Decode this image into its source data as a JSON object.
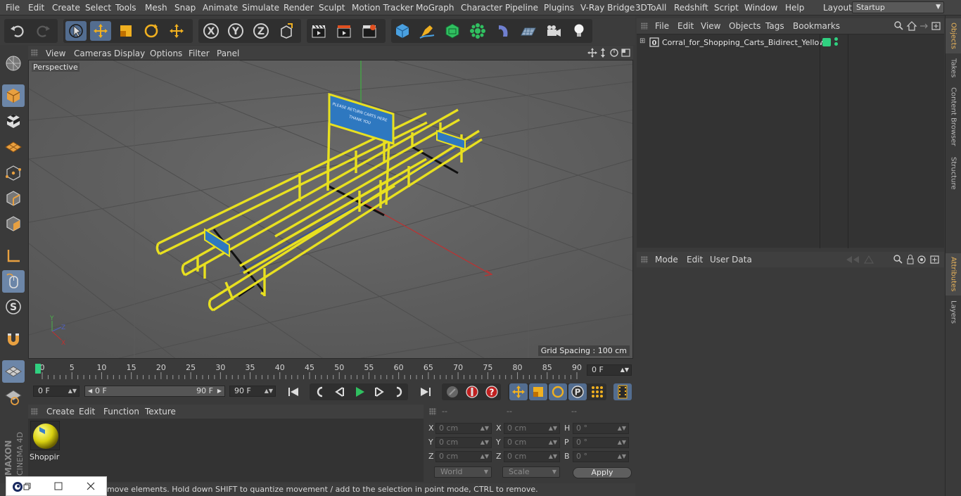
{
  "menubar": {
    "items": [
      "File",
      "Edit",
      "Create",
      "Select",
      "Tools",
      "Mesh",
      "Snap",
      "Animate",
      "Simulate",
      "Render",
      "Sculpt",
      "Motion Tracker",
      "MoGraph",
      "Character",
      "Pipeline",
      "Plugins",
      "V-Ray Bridge",
      "3DToAll",
      "Redshift",
      "Script",
      "Window",
      "Help"
    ],
    "layout_label": "Layout:",
    "layout_value": "Startup"
  },
  "viewport": {
    "menu": [
      "View",
      "Cameras",
      "Display",
      "Options",
      "Filter",
      "Panel"
    ],
    "name": "Perspective",
    "grid_spacing": "Grid Spacing : 100 cm",
    "sign_line1": "PLEASE RETURN CARTS HERE",
    "sign_line2": "THANK YOU",
    "axis_x": "X",
    "axis_y": "Y",
    "axis_z": "Z"
  },
  "timeline": {
    "ticks": [
      "0",
      "5",
      "10",
      "15",
      "20",
      "25",
      "30",
      "35",
      "40",
      "45",
      "50",
      "55",
      "60",
      "65",
      "70",
      "75",
      "80",
      "85",
      "90"
    ],
    "current_frame": "0 F"
  },
  "playback": {
    "start_field": "0 F",
    "range_start": "0 F",
    "range_end": "90 F",
    "end_field": "90 F"
  },
  "material_manager": {
    "menu": [
      "Create",
      "Edit",
      "Function",
      "Texture"
    ],
    "material_name": "Shoppir"
  },
  "coordinates": {
    "headers": [
      "--",
      "--",
      "--"
    ],
    "rows": [
      {
        "l1": "X",
        "v1": "0 cm",
        "l2": "X",
        "v2": "0 cm",
        "l3": "H",
        "v3": "0 °"
      },
      {
        "l1": "Y",
        "v1": "0 cm",
        "l2": "Y",
        "v2": "0 cm",
        "l3": "P",
        "v3": "0 °"
      },
      {
        "l1": "Z",
        "v1": "0 cm",
        "l2": "Z",
        "v2": "0 cm",
        "l3": "B",
        "v3": "0 °"
      }
    ],
    "mode_world": "World",
    "mode_scale": "Scale",
    "apply": "Apply"
  },
  "status": "move elements. Hold down SHIFT to quantize movement / add to the selection in point mode, CTRL to remove.",
  "objects_manager": {
    "menu": [
      "File",
      "Edit",
      "View",
      "Objects",
      "Tags",
      "Bookmarks"
    ],
    "object_name": "Corral_for_Shopping_Carts_Bidirect_Yellow"
  },
  "attributes_manager": {
    "menu": [
      "Mode",
      "Edit",
      "User Data"
    ]
  },
  "side_tabs": [
    "Objects",
    "Takes",
    "Content Browser",
    "Structure",
    "Attributes",
    "Layers"
  ],
  "logo": {
    "line1": "MAXON",
    "line2": "CINEMA 4D"
  },
  "colors": {
    "accent": "#6c86a8",
    "yellow": "#e8e020",
    "sign_blue": "#2e78c0",
    "tab_highlight": "#e8b35a"
  }
}
